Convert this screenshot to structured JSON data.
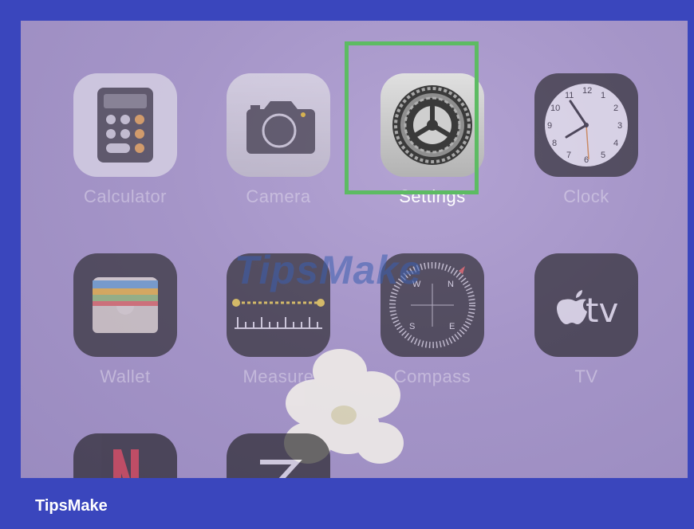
{
  "apps": {
    "calculator": "Calculator",
    "camera": "Camera",
    "settings": "Settings",
    "clock": "Clock",
    "wallet": "Wallet",
    "measure": "Measure",
    "compass": "Compass",
    "tv": "TV"
  },
  "clock_face": [
    "12",
    "1",
    "2",
    "3",
    "4",
    "5",
    "6",
    "7",
    "8",
    "9",
    "10",
    "11"
  ],
  "compass_face": {
    "w": "W",
    "n": "N",
    "s": "S",
    "e": "E"
  },
  "tv_icon_text": "tv",
  "highlight_color": "#5dbb63",
  "watermark": "TipsMake",
  "footer": {
    "brand": "TipsMake"
  }
}
